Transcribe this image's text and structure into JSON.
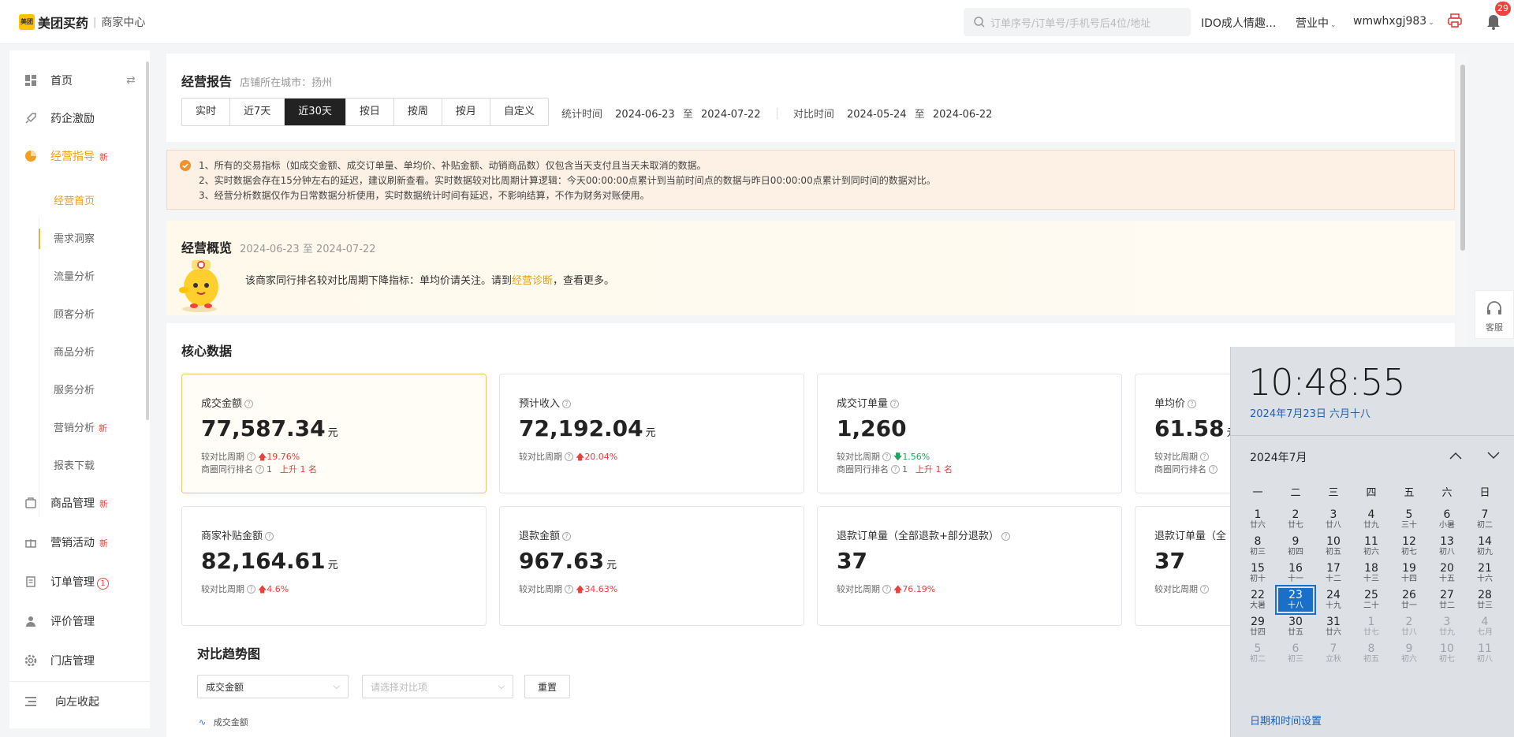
{
  "header": {
    "logo_badge": "美团",
    "brand": "美团买药",
    "subtitle": "商家中心",
    "search_placeholder": "订单序号/订单号/手机号后4位/地址",
    "store_name": "IDO成人情趣...",
    "status": "营业中",
    "account": "wmwhxgj983",
    "notif_count": "29"
  },
  "sidebar": {
    "items": [
      {
        "label": "首页",
        "icon": "home-icon",
        "new": ""
      },
      {
        "label": "药企激励",
        "icon": "rocket-icon",
        "new": ""
      },
      {
        "label": "经营指导",
        "icon": "pie-chart-icon",
        "new": "新"
      },
      {
        "label": "商品管理",
        "icon": "product-icon",
        "new": "新"
      },
      {
        "label": "营销活动",
        "icon": "gift-icon",
        "new": "新"
      },
      {
        "label": "订单管理",
        "icon": "order-icon",
        "badge": "1"
      },
      {
        "label": "评价管理",
        "icon": "user-icon",
        "new": ""
      },
      {
        "label": "门店管理",
        "icon": "settings-icon",
        "new": ""
      }
    ],
    "sub_items": [
      {
        "label": "经营首页"
      },
      {
        "label": "需求洞察"
      },
      {
        "label": "流量分析"
      },
      {
        "label": "顾客分析"
      },
      {
        "label": "商品分析"
      },
      {
        "label": "服务分析"
      },
      {
        "label": "营销分析",
        "new": "新"
      },
      {
        "label": "报表下载"
      }
    ],
    "collapse_label": "向左收起"
  },
  "report": {
    "title": "经营报告",
    "city_label": "店铺所在城市：扬州",
    "tabs": [
      "实时",
      "近7天",
      "近30天",
      "按日",
      "按周",
      "按月",
      "自定义"
    ],
    "active_tab": "近30天",
    "stat_label": "统计时间",
    "stat_start": "2024-06-23",
    "stat_to": "至",
    "stat_end": "2024-07-22",
    "cmp_label": "对比时间",
    "cmp_start": "2024-05-24",
    "cmp_to": "至",
    "cmp_end": "2024-06-22"
  },
  "notice": {
    "lines": [
      "1、所有的交易指标（如成交金额、成交订单量、单均价、补贴金额、动销商品数）仅包含当天支付且当天未取消的数据。",
      "2、实时数据会存在15分钟左右的延迟，建议刷新查看。实时数据较对比周期计算逻辑：今天00:00:00点累计到当前时间点的数据与昨日00:00:00点累计到同时间的数据对比。",
      "3、经营分析数据仅作为日常数据分析使用，实时数据统计时间有延迟，不影响结算，不作为财务对账使用。"
    ]
  },
  "overview": {
    "title": "经营概览",
    "range": "2024-06-23 至 2024-07-22",
    "msg_pre": "该商家同行排名较对比周期下降指标：单均价请关注。请到",
    "msg_link": "经营诊断",
    "msg_post": "，查看更多。"
  },
  "core": {
    "title": "核心数据",
    "cmp_label": "较对比周期",
    "rank_label": "商圈同行排名",
    "cards": [
      {
        "title": "成交金额",
        "value": "77,587.34",
        "unit": "元",
        "change": "19.76%",
        "dir": "up",
        "rank": "1",
        "rank_change": "上升 1 名"
      },
      {
        "title": "预计收入",
        "value": "72,192.04",
        "unit": "元",
        "change": "20.04%",
        "dir": "up"
      },
      {
        "title": "成交订单量",
        "value": "1,260",
        "unit": "",
        "change": "1.56%",
        "dir": "down",
        "rank": "1",
        "rank_change": "上升 1 名"
      },
      {
        "title": "单均价",
        "value": "61.58",
        "unit": "元",
        "change": "",
        "dir": "up"
      },
      {
        "title": "商家补贴金额",
        "value": "82,164.61",
        "unit": "元",
        "change": "4.6%",
        "dir": "up"
      },
      {
        "title": "退款金额",
        "value": "967.63",
        "unit": "元",
        "change": "34.63%",
        "dir": "up"
      },
      {
        "title": "退款订单量（全部退款+部分退款）",
        "value": "37",
        "unit": "",
        "change": "76.19%",
        "dir": "up"
      },
      {
        "title": "退款订单量（全",
        "value": "37",
        "unit": "",
        "change": "",
        "dir": "up"
      }
    ]
  },
  "trend": {
    "title": "对比趋势图",
    "metric_select": "成交金额",
    "compare_placeholder": "请选择对比项",
    "reset_label": "重置",
    "legend": "成交金额"
  },
  "float": {
    "service_label": "客服"
  },
  "calendar": {
    "time": "10:48:55",
    "date": "2024年7月23日 六月十八",
    "month": "2024年7月",
    "weekdays": [
      "一",
      "二",
      "三",
      "四",
      "五",
      "六",
      "日"
    ],
    "weeks": [
      [
        [
          "1",
          "廿六",
          0
        ],
        [
          "2",
          "廿七",
          0
        ],
        [
          "3",
          "廿八",
          0
        ],
        [
          "4",
          "廿九",
          0
        ],
        [
          "5",
          "三十",
          0
        ],
        [
          "6",
          "小暑",
          0
        ],
        [
          "7",
          "初二",
          0
        ]
      ],
      [
        [
          "8",
          "初三",
          0
        ],
        [
          "9",
          "初四",
          0
        ],
        [
          "10",
          "初五",
          0
        ],
        [
          "11",
          "初六",
          0
        ],
        [
          "12",
          "初七",
          0
        ],
        [
          "13",
          "初八",
          0
        ],
        [
          "14",
          "初九",
          0
        ]
      ],
      [
        [
          "15",
          "初十",
          0
        ],
        [
          "16",
          "十一",
          0
        ],
        [
          "17",
          "十二",
          0
        ],
        [
          "18",
          "十三",
          0
        ],
        [
          "19",
          "十四",
          0
        ],
        [
          "20",
          "十五",
          0
        ],
        [
          "21",
          "十六",
          0
        ]
      ],
      [
        [
          "22",
          "大暑",
          0
        ],
        [
          "23",
          "十八",
          2
        ],
        [
          "24",
          "十九",
          0
        ],
        [
          "25",
          "二十",
          0
        ],
        [
          "26",
          "廿一",
          0
        ],
        [
          "27",
          "廿二",
          0
        ],
        [
          "28",
          "廿三",
          0
        ]
      ],
      [
        [
          "29",
          "廿四",
          0
        ],
        [
          "30",
          "廿五",
          0
        ],
        [
          "31",
          "廿六",
          0
        ],
        [
          "1",
          "廿七",
          1
        ],
        [
          "2",
          "廿八",
          1
        ],
        [
          "3",
          "廿九",
          1
        ],
        [
          "4",
          "七月",
          1
        ]
      ],
      [
        [
          "5",
          "初二",
          1
        ],
        [
          "6",
          "初三",
          1
        ],
        [
          "7",
          "立秋",
          1
        ],
        [
          "8",
          "初五",
          1
        ],
        [
          "9",
          "初六",
          1
        ],
        [
          "10",
          "初七",
          1
        ],
        [
          "11",
          "初八",
          1
        ]
      ]
    ],
    "settings_link": "日期和时间设置"
  },
  "colors": {
    "accent": "#f0a020",
    "up": "#e8413c",
    "down": "#21a55d",
    "today": "#1a6fc9"
  }
}
